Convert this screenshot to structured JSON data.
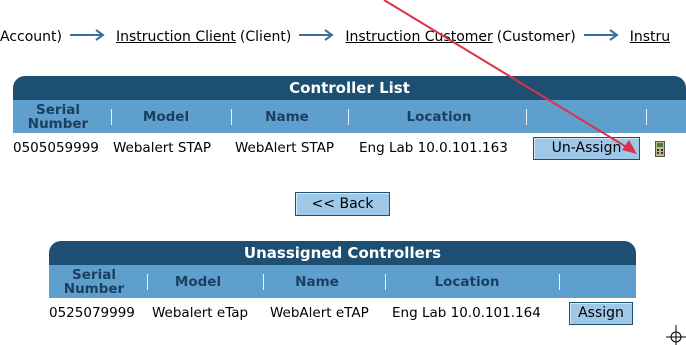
{
  "breadcrumb": {
    "lead": "Account)",
    "items": [
      {
        "link": "Instruction Client",
        "paren": "(Client)"
      },
      {
        "link": "Instruction Customer",
        "paren": "(Customer)"
      },
      {
        "link": "Instru",
        "paren": ""
      }
    ]
  },
  "controller_list": {
    "title": "Controller List",
    "columns": [
      "Serial Number",
      "Model",
      "Name",
      "Location"
    ],
    "rows": [
      {
        "serial": "0505059999",
        "model": "Webalert STAP",
        "name": "WebAlert STAP",
        "location": "Eng Lab 10.0.101.163",
        "action": "Un-Assign"
      }
    ]
  },
  "back_button": "<< Back",
  "unassigned_controllers": {
    "title": "Unassigned Controllers",
    "columns": [
      "Serial Number",
      "Model",
      "Name",
      "Location"
    ],
    "rows": [
      {
        "serial": "0525079999",
        "model": "Webalert eTap",
        "name": "WebAlert eTAP",
        "location": "Eng Lab 10.0.101.164",
        "action": "Assign"
      }
    ]
  },
  "colors": {
    "title_bar": "#1d4f73",
    "header_bar": "#5f9fce",
    "button": "#9fc7e8",
    "annotation_arrow": "#d9334a"
  },
  "icons": [
    "arrow-right-icon",
    "device-icon",
    "crosshair-cursor-icon"
  ]
}
